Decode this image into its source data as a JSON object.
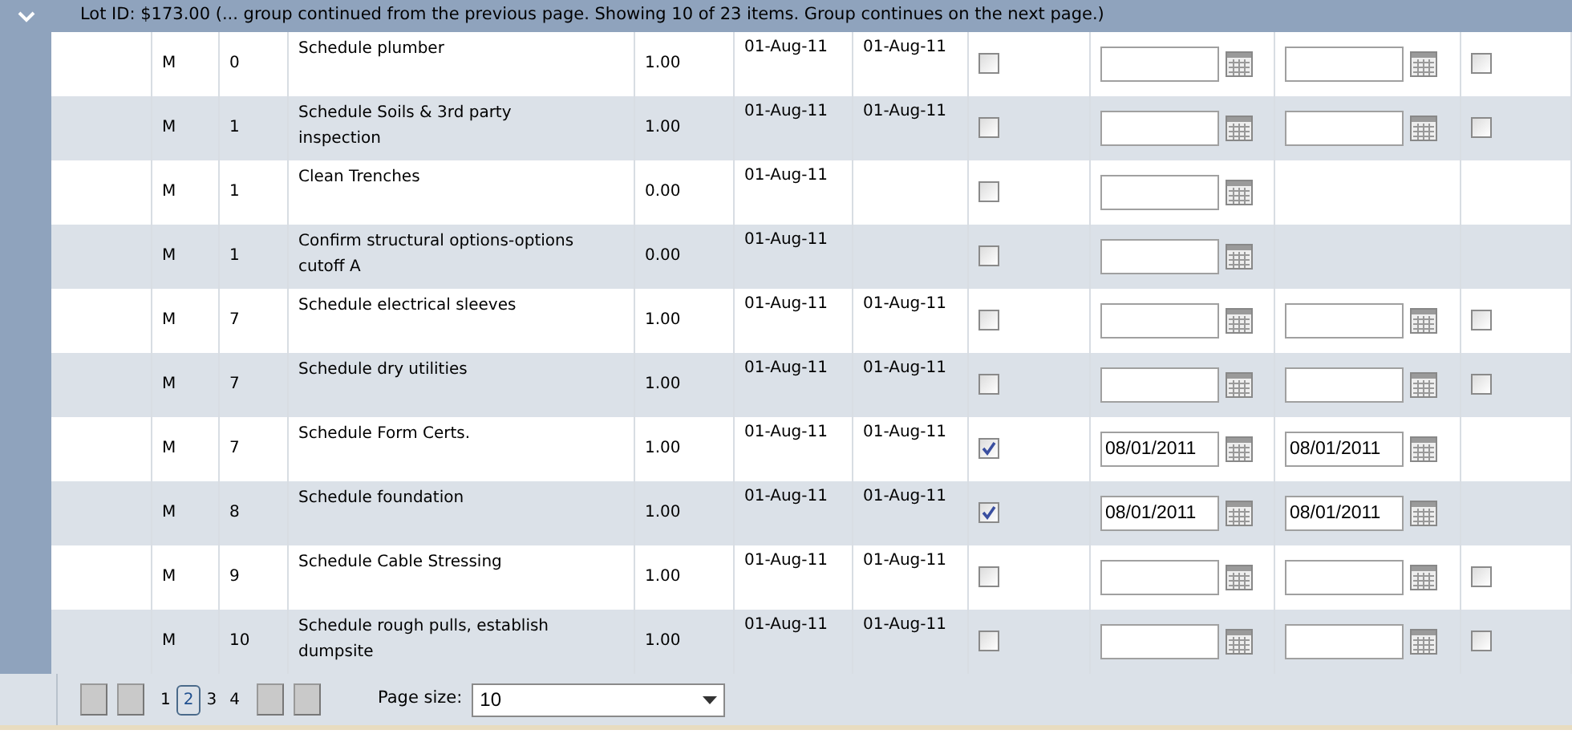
{
  "group_header": {
    "expanded": true,
    "text": "Lot ID: $173.00 (... group continued from the previous page. Showing 10 of 23 items. Group continues on the next page.)"
  },
  "rows": [
    {
      "type": "M",
      "number": "0",
      "description": "Schedule plumber",
      "quantity": "1.00",
      "start": "01-Aug-11",
      "end": "01-Aug-11",
      "done": false,
      "date_fields": [
        {
          "kind": "date_input"
        },
        {
          "kind": "date_input"
        }
      ],
      "extra_check": {
        "checked": false
      }
    },
    {
      "type": "M",
      "number": "1",
      "description": "Schedule Soils & 3rd party inspection",
      "quantity": "1.00",
      "start": "01-Aug-11",
      "end": "01-Aug-11",
      "done": false,
      "date_fields": [
        {
          "kind": "date_input"
        },
        {
          "kind": "date_input"
        }
      ],
      "extra_check": {
        "checked": false
      }
    },
    {
      "type": "M",
      "number": "1",
      "description": "Clean Trenches",
      "quantity": "0.00",
      "start": "01-Aug-11",
      "done": false,
      "date_fields": [
        {
          "kind": "date_input"
        }
      ]
    },
    {
      "type": "M",
      "number": "1",
      "description": "Confirm structural options-options cutoff A",
      "quantity": "0.00",
      "start": "01-Aug-11",
      "done": false,
      "date_fields": [
        {
          "kind": "date_input"
        }
      ]
    },
    {
      "type": "M",
      "number": "7",
      "description": "Schedule electrical sleeves",
      "quantity": "1.00",
      "start": "01-Aug-11",
      "end": "01-Aug-11",
      "done": false,
      "date_fields": [
        {
          "kind": "date_input"
        },
        {
          "kind": "date_input"
        }
      ],
      "extra_check": {
        "checked": false
      }
    },
    {
      "type": "M",
      "number": "7",
      "description": "Schedule dry utilities",
      "quantity": "1.00",
      "start": "01-Aug-11",
      "end": "01-Aug-11",
      "done": false,
      "date_fields": [
        {
          "kind": "date_input"
        },
        {
          "kind": "date_input"
        }
      ],
      "extra_check": {
        "checked": false
      }
    },
    {
      "type": "M",
      "number": "7",
      "description": "Schedule Form Certs.",
      "quantity": "1.00",
      "start": "01-Aug-11",
      "end": "01-Aug-11",
      "done": true,
      "date_fields": [
        {
          "kind": "date_input",
          "value": "08/01/2011"
        },
        {
          "kind": "date_input",
          "value": "08/01/2011"
        }
      ]
    },
    {
      "type": "M",
      "number": "8",
      "description": "Schedule foundation",
      "quantity": "1.00",
      "start": "01-Aug-11",
      "end": "01-Aug-11",
      "done": true,
      "date_fields": [
        {
          "kind": "date_input",
          "value": "08/01/2011"
        },
        {
          "kind": "date_input",
          "value": "08/01/2011"
        }
      ]
    },
    {
      "type": "M",
      "number": "9",
      "description": "Schedule Cable Stressing",
      "quantity": "1.00",
      "start": "01-Aug-11",
      "end": "01-Aug-11",
      "done": false,
      "date_fields": [
        {
          "kind": "date_input"
        },
        {
          "kind": "date_input"
        }
      ],
      "extra_check": {
        "checked": false
      }
    },
    {
      "type": "M",
      "number": "10",
      "description": "Schedule rough pulls, establish dumpsite",
      "quantity": "1.00",
      "start": "01-Aug-11",
      "end": "01-Aug-11",
      "done": false,
      "date_fields": [
        {
          "kind": "date_input"
        },
        {
          "kind": "date_input"
        }
      ],
      "extra_check": {
        "checked": false
      }
    }
  ],
  "pager": {
    "pages": [
      {
        "label": "1",
        "selected": false
      },
      {
        "label": "2",
        "selected": true
      },
      {
        "label": "3",
        "selected": false
      },
      {
        "label": "4",
        "selected": false
      }
    ],
    "page_size_label": "Page size:",
    "page_size": "10"
  }
}
